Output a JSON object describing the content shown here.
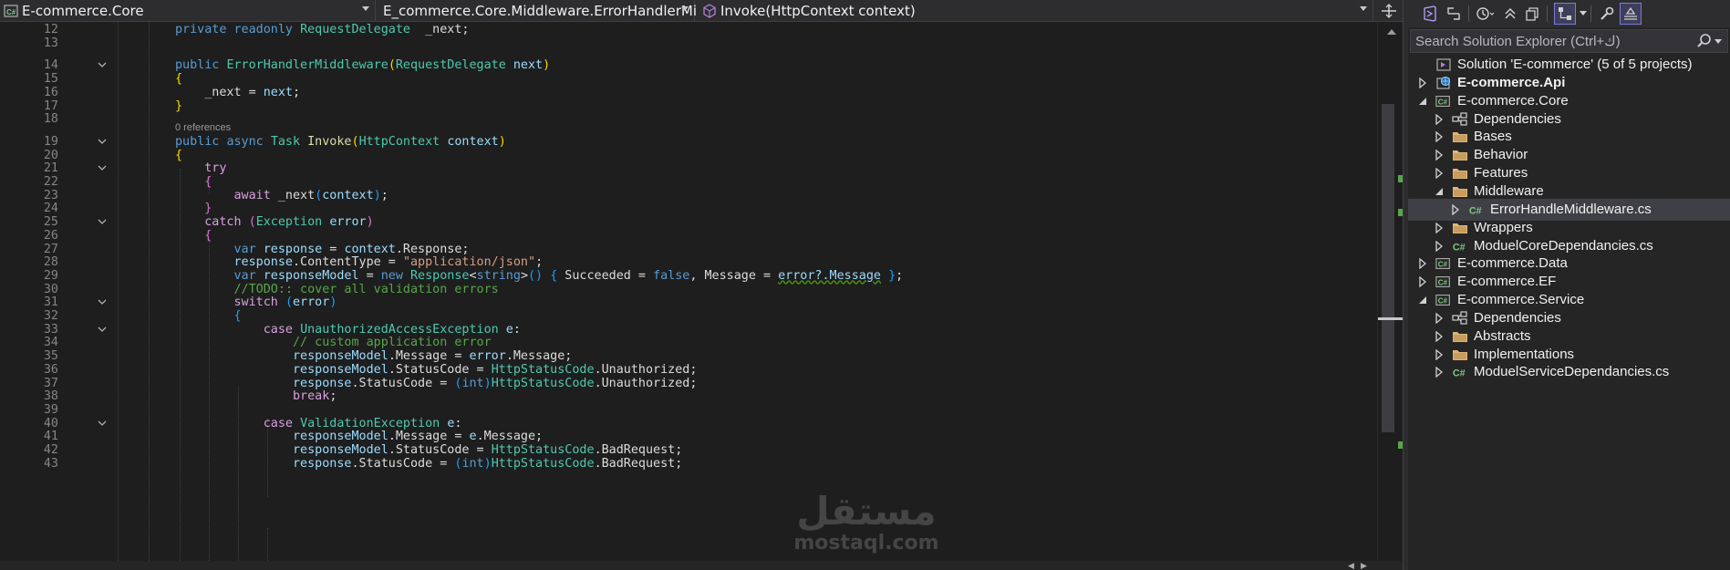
{
  "navbar": {
    "project": "E-commerce.Core",
    "type": "E_commerce.Core.Middleware.ErrorHandlerMi",
    "member": "Invoke(HttpContext context)"
  },
  "editor": {
    "codelens": "0 references",
    "lines": [
      {
        "n": "12",
        "tokens": [
          [
            "kw",
            "private "
          ],
          [
            "kw",
            "readonly "
          ],
          [
            "typ",
            "RequestDelegate"
          ],
          [
            "",
            "  _next;"
          ]
        ]
      },
      {
        "n": "13",
        "tokens": []
      },
      {
        "n": "14",
        "tokens": [
          [
            "kw",
            "public "
          ],
          [
            "typ",
            "ErrorHandlerMiddleware"
          ],
          [
            "by",
            "("
          ],
          [
            "typ",
            "RequestDelegate"
          ],
          [
            "",
            " "
          ],
          [
            "prm",
            "next"
          ],
          [
            "by",
            ")"
          ]
        ]
      },
      {
        "n": "15",
        "tokens": [
          [
            "by",
            "{"
          ]
        ]
      },
      {
        "n": "16",
        "tokens": [
          [
            "",
            "    _next = "
          ],
          [
            "prm",
            "next"
          ],
          [
            "",
            ";"
          ]
        ]
      },
      {
        "n": "17",
        "tokens": [
          [
            "by",
            "}"
          ]
        ]
      },
      {
        "n": "18",
        "tokens": []
      },
      {
        "n": "19",
        "tokens": [
          [
            "kw",
            "public "
          ],
          [
            "kw",
            "async "
          ],
          [
            "typ",
            "Task "
          ],
          [
            "mth",
            "Invoke"
          ],
          [
            "by",
            "("
          ],
          [
            "typ",
            "HttpContext"
          ],
          [
            "",
            " "
          ],
          [
            "prm",
            "context"
          ],
          [
            "by",
            ")"
          ]
        ]
      },
      {
        "n": "20",
        "tokens": [
          [
            "by",
            "{"
          ]
        ]
      },
      {
        "n": "21",
        "tokens": [
          [
            "",
            "    "
          ],
          [
            "ctl",
            "try"
          ]
        ]
      },
      {
        "n": "22",
        "tokens": [
          [
            "",
            "    "
          ],
          [
            "bp",
            "{"
          ]
        ]
      },
      {
        "n": "23",
        "tokens": [
          [
            "",
            "        "
          ],
          [
            "ctl",
            "await "
          ],
          [
            "",
            "_next"
          ],
          [
            "bb",
            "("
          ],
          [
            "prm",
            "context"
          ],
          [
            "bb",
            ")"
          ],
          [
            "",
            ";"
          ]
        ]
      },
      {
        "n": "24",
        "tokens": [
          [
            "",
            "    "
          ],
          [
            "bp",
            "}"
          ]
        ]
      },
      {
        "n": "25",
        "tokens": [
          [
            "",
            "    "
          ],
          [
            "ctl",
            "catch "
          ],
          [
            "bp",
            "("
          ],
          [
            "typ",
            "Exception"
          ],
          [
            "",
            " "
          ],
          [
            "prm",
            "error"
          ],
          [
            "bp",
            ")"
          ]
        ]
      },
      {
        "n": "26",
        "tokens": [
          [
            "",
            "    "
          ],
          [
            "bp",
            "{"
          ]
        ]
      },
      {
        "n": "27",
        "tokens": [
          [
            "",
            "        "
          ],
          [
            "kw",
            "var "
          ],
          [
            "prm",
            "response"
          ],
          [
            "",
            " = "
          ],
          [
            "prm",
            "context"
          ],
          [
            "",
            ".Response;"
          ]
        ]
      },
      {
        "n": "28",
        "tokens": [
          [
            "",
            "        "
          ],
          [
            "prm",
            "response"
          ],
          [
            "",
            ".ContentType = "
          ],
          [
            "str",
            "\"application/json\""
          ],
          [
            "",
            ";"
          ]
        ]
      },
      {
        "n": "29",
        "tokens": [
          [
            "",
            "        "
          ],
          [
            "kw",
            "var "
          ],
          [
            "prm",
            "responseModel"
          ],
          [
            "",
            " = "
          ],
          [
            "kw",
            "new "
          ],
          [
            "typ",
            "Response"
          ],
          [
            "",
            "<"
          ],
          [
            "kw",
            "string"
          ],
          [
            "",
            ">"
          ],
          [
            "bb",
            "()"
          ],
          [
            "",
            " "
          ],
          [
            "bb",
            "{"
          ],
          [
            "",
            " Succeeded = "
          ],
          [
            "kw",
            "false"
          ],
          [
            "",
            ", Message = "
          ],
          [
            "prm squig",
            "error?.Message"
          ],
          [
            "",
            " "
          ],
          [
            "bb",
            "}"
          ],
          [
            "",
            ";"
          ]
        ]
      },
      {
        "n": "30",
        "tokens": [
          [
            "",
            "        "
          ],
          [
            "cmt",
            "//TODO:: cover all validation errors"
          ]
        ]
      },
      {
        "n": "31",
        "tokens": [
          [
            "",
            "        "
          ],
          [
            "ctl",
            "switch "
          ],
          [
            "bb",
            "("
          ],
          [
            "prm",
            "error"
          ],
          [
            "bb",
            ")"
          ]
        ]
      },
      {
        "n": "32",
        "tokens": [
          [
            "",
            "        "
          ],
          [
            "bb",
            "{"
          ]
        ]
      },
      {
        "n": "33",
        "tokens": [
          [
            "",
            "            "
          ],
          [
            "ctl",
            "case "
          ],
          [
            "typ",
            "UnauthorizedAccessException"
          ],
          [
            "",
            " "
          ],
          [
            "prm",
            "e"
          ],
          [
            "",
            ":"
          ]
        ]
      },
      {
        "n": "34",
        "tokens": [
          [
            "",
            "                "
          ],
          [
            "cmt",
            "// custom application error"
          ]
        ]
      },
      {
        "n": "35",
        "tokens": [
          [
            "",
            "                "
          ],
          [
            "prm",
            "responseModel"
          ],
          [
            "",
            ".Message = "
          ],
          [
            "prm",
            "error"
          ],
          [
            "",
            ".Message;"
          ]
        ]
      },
      {
        "n": "36",
        "tokens": [
          [
            "",
            "                "
          ],
          [
            "prm",
            "responseModel"
          ],
          [
            "",
            ".StatusCode = "
          ],
          [
            "typ",
            "HttpStatusCode"
          ],
          [
            "",
            ".Unauthorized;"
          ]
        ]
      },
      {
        "n": "37",
        "tokens": [
          [
            "",
            "                "
          ],
          [
            "prm",
            "response"
          ],
          [
            "",
            ".StatusCode = "
          ],
          [
            "bb",
            "("
          ],
          [
            "kw",
            "int"
          ],
          [
            "bb",
            ")"
          ],
          [
            "typ",
            "HttpStatusCode"
          ],
          [
            "",
            ".Unauthorized;"
          ]
        ]
      },
      {
        "n": "38",
        "tokens": [
          [
            "",
            "                "
          ],
          [
            "ctl",
            "break"
          ],
          [
            "",
            ";"
          ]
        ]
      },
      {
        "n": "39",
        "tokens": []
      },
      {
        "n": "40",
        "tokens": [
          [
            "",
            "            "
          ],
          [
            "ctl",
            "case "
          ],
          [
            "typ",
            "ValidationException"
          ],
          [
            "",
            " "
          ],
          [
            "prm",
            "e"
          ],
          [
            "",
            ":"
          ]
        ]
      },
      {
        "n": "41",
        "tokens": [
          [
            "",
            "                "
          ],
          [
            "prm",
            "responseModel"
          ],
          [
            "",
            ".Message = "
          ],
          [
            "prm",
            "e"
          ],
          [
            "",
            ".Message;"
          ]
        ]
      },
      {
        "n": "42",
        "tokens": [
          [
            "",
            "                "
          ],
          [
            "prm",
            "responseModel"
          ],
          [
            "",
            ".StatusCode = "
          ],
          [
            "typ",
            "HttpStatusCode"
          ],
          [
            "",
            ".BadRequest;"
          ]
        ]
      },
      {
        "n": "43",
        "tokens": [
          [
            "",
            "                "
          ],
          [
            "prm",
            "response"
          ],
          [
            "",
            ".StatusCode = "
          ],
          [
            "bb",
            "("
          ],
          [
            "kw",
            "int"
          ],
          [
            "bb",
            ")"
          ],
          [
            "typ",
            "HttpStatusCode"
          ],
          [
            "",
            ".BadRequest;"
          ]
        ]
      }
    ]
  },
  "solution_explorer": {
    "search_placeholder": "Search Solution Explorer (Ctrl+ك)",
    "items": [
      {
        "label": "Solution 'E-commerce' (5 of 5 projects)",
        "icon": "solution-icon",
        "level": 0,
        "expander": "none",
        "bold": false
      },
      {
        "label": "E-commerce.Api",
        "icon": "web-project-icon",
        "level": 0,
        "expander": "collapsed",
        "bold": true
      },
      {
        "label": "E-commerce.Core",
        "icon": "csharp-project-icon",
        "level": 0,
        "expander": "expanded",
        "bold": false
      },
      {
        "label": "Dependencies",
        "icon": "dependencies-icon",
        "level": 1,
        "expander": "collapsed",
        "bold": false
      },
      {
        "label": "Bases",
        "icon": "folder-icon",
        "level": 1,
        "expander": "collapsed",
        "bold": false
      },
      {
        "label": "Behavior",
        "icon": "folder-icon",
        "level": 1,
        "expander": "collapsed",
        "bold": false
      },
      {
        "label": "Features",
        "icon": "folder-icon",
        "level": 1,
        "expander": "collapsed",
        "bold": false
      },
      {
        "label": "Middleware",
        "icon": "folder-icon",
        "level": 1,
        "expander": "expanded",
        "bold": false
      },
      {
        "label": "ErrorHandleMiddleware.cs",
        "icon": "csharp-file-icon",
        "level": 2,
        "expander": "collapsed",
        "bold": false,
        "selected": true
      },
      {
        "label": "Wrappers",
        "icon": "folder-icon",
        "level": 1,
        "expander": "collapsed",
        "bold": false
      },
      {
        "label": "ModuelCoreDependancies.cs",
        "icon": "csharp-file-icon",
        "level": 1,
        "expander": "collapsed",
        "bold": false
      },
      {
        "label": "E-commerce.Data",
        "icon": "csharp-project-icon",
        "level": 0,
        "expander": "collapsed",
        "bold": false
      },
      {
        "label": "E-commerce.EF",
        "icon": "csharp-project-icon",
        "level": 0,
        "expander": "collapsed",
        "bold": false
      },
      {
        "label": "E-commerce.Service",
        "icon": "csharp-project-icon",
        "level": 0,
        "expander": "expanded",
        "bold": false
      },
      {
        "label": "Dependencies",
        "icon": "dependencies-icon",
        "level": 1,
        "expander": "collapsed",
        "bold": false
      },
      {
        "label": "Abstracts",
        "icon": "folder-icon",
        "level": 1,
        "expander": "collapsed",
        "bold": false
      },
      {
        "label": "Implementations",
        "icon": "folder-icon",
        "level": 1,
        "expander": "collapsed",
        "bold": false
      },
      {
        "label": "ModuelServiceDependancies.cs",
        "icon": "csharp-file-icon",
        "level": 1,
        "expander": "collapsed",
        "bold": false
      }
    ]
  },
  "watermark": {
    "arabic": "مستقل",
    "latin": "mostaql.com"
  },
  "colors": {
    "editor_bg": "#1e1e1e",
    "panel_bg": "#252526",
    "selection": "#3f3f46",
    "folder": "#dcb67a",
    "csharp": "#7ec880"
  }
}
